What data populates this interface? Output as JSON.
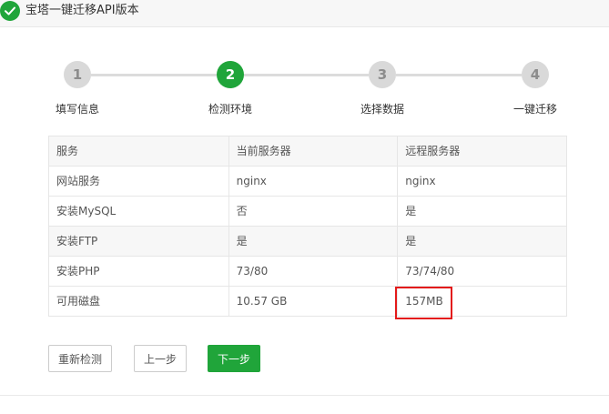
{
  "window": {
    "title": "宝塔一键迁移API版本"
  },
  "steps": [
    {
      "number": "1",
      "label": "填写信息",
      "state": "done"
    },
    {
      "number": "2",
      "label": "检测环境",
      "state": "active"
    },
    {
      "number": "3",
      "label": "选择数据",
      "state": "pending"
    },
    {
      "number": "4",
      "label": "一键迁移",
      "state": "pending"
    }
  ],
  "table": {
    "headers": [
      "服务",
      "当前服务器",
      "远程服务器"
    ],
    "rows": [
      [
        "网站服务",
        "nginx",
        "nginx"
      ],
      [
        "安装MySQL",
        "否",
        "是"
      ],
      [
        "安装FTP",
        "是",
        "是"
      ],
      [
        "安装PHP",
        "73/80",
        "73/74/80"
      ],
      [
        "可用磁盘",
        "10.57 GB",
        "157MB"
      ]
    ]
  },
  "buttons": {
    "recheck": "重新检测",
    "prev": "上一步",
    "next": "下一步"
  },
  "colors": {
    "accent": "#20a53a",
    "highlight": "#e31a1a"
  }
}
